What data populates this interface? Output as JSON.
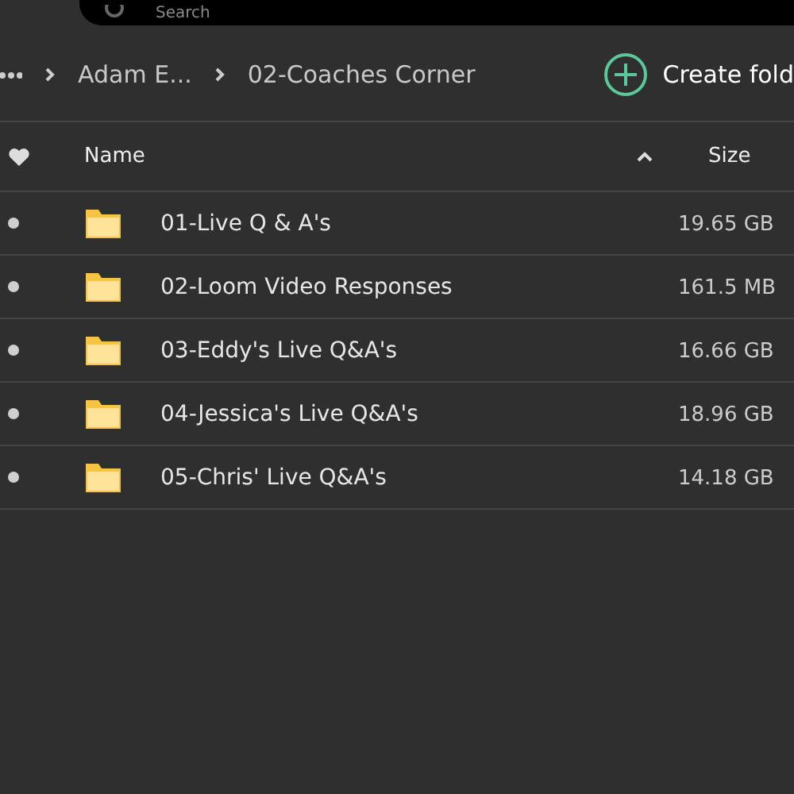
{
  "search": {
    "placeholder": "Search"
  },
  "breadcrumb": {
    "items": [
      "Adam E...",
      "02-Coaches Corner"
    ]
  },
  "create_button": {
    "label": "Create fold"
  },
  "table": {
    "columns": [
      "Name",
      "Size"
    ],
    "sort_ascending": true,
    "rows": [
      {
        "name": "01-Live Q & A's",
        "size": "19.65 GB"
      },
      {
        "name": "02-Loom Video Responses",
        "size": "161.5 MB"
      },
      {
        "name": "03-Eddy's Live Q&A's",
        "size": "16.66 GB"
      },
      {
        "name": "04-Jessica's Live Q&A's",
        "size": "18.96 GB"
      },
      {
        "name": "05-Chris' Live Q&A's",
        "size": "14.18 GB"
      }
    ]
  }
}
